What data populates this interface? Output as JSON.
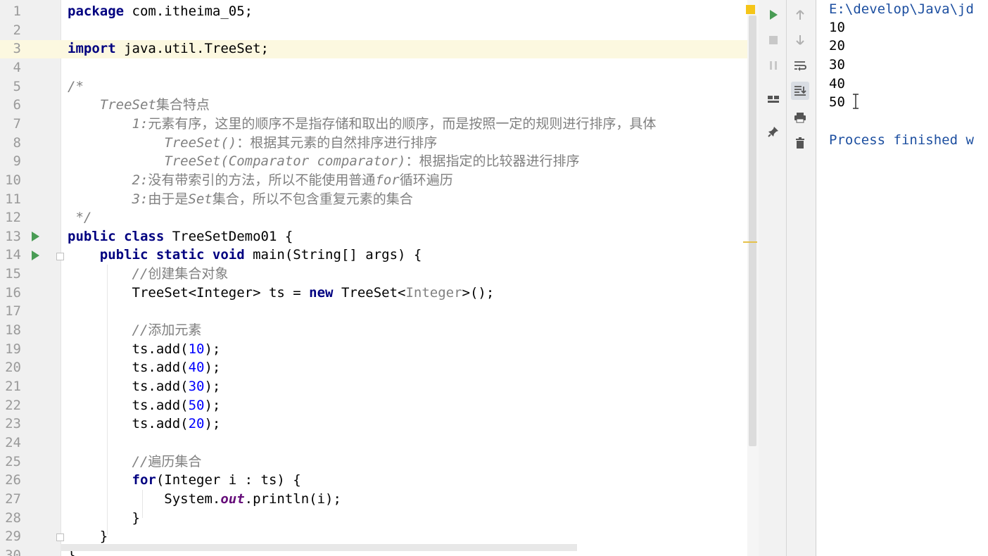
{
  "editor": {
    "lines": [
      {
        "n": "1",
        "parts": [
          {
            "t": "package",
            "c": "kw"
          },
          {
            "t": " com.itheima_05;"
          }
        ]
      },
      {
        "n": "2",
        "parts": []
      },
      {
        "n": "3",
        "parts": [
          {
            "t": "import",
            "c": "kw"
          },
          {
            "t": " java.util.TreeSet;"
          }
        ]
      },
      {
        "n": "4",
        "parts": []
      },
      {
        "n": "5",
        "parts": [
          {
            "t": "/*",
            "c": "cm"
          }
        ]
      },
      {
        "n": "6",
        "parts": [
          {
            "t": "    TreeSet",
            "c": "cm"
          },
          {
            "t": "集合特点",
            "c": "cm2"
          }
        ]
      },
      {
        "n": "7",
        "parts": [
          {
            "t": "        1:",
            "c": "cm"
          },
          {
            "t": "元素有序，这里的顺序不是指存储和取出的顺序，而是按照一定的规则进行排序，具体",
            "c": "cm2"
          }
        ]
      },
      {
        "n": "8",
        "parts": [
          {
            "t": "            TreeSet()",
            "c": "cm"
          },
          {
            "t": "：根据其元素的自然排序进行排序",
            "c": "cm2"
          }
        ]
      },
      {
        "n": "9",
        "parts": [
          {
            "t": "            TreeSet(Comparator comparator)",
            "c": "cm"
          },
          {
            "t": "：根据指定的比较器进行排序",
            "c": "cm2"
          }
        ]
      },
      {
        "n": "10",
        "parts": [
          {
            "t": "        2:",
            "c": "cm"
          },
          {
            "t": "没有带索引的方法，所以不能使用普通",
            "c": "cm2"
          },
          {
            "t": "for",
            "c": "cm"
          },
          {
            "t": "循环遍历",
            "c": "cm2"
          }
        ]
      },
      {
        "n": "11",
        "parts": [
          {
            "t": "        3:",
            "c": "cm"
          },
          {
            "t": "由于是",
            "c": "cm2"
          },
          {
            "t": "Set",
            "c": "cm"
          },
          {
            "t": "集合，所以不包含重复元素的集合",
            "c": "cm2"
          }
        ]
      },
      {
        "n": "12",
        "parts": [
          {
            "t": " */",
            "c": "cm"
          }
        ]
      },
      {
        "n": "13",
        "parts": [
          {
            "t": "public class",
            "c": "kw"
          },
          {
            "t": " TreeSetDemo01 {"
          }
        ]
      },
      {
        "n": "14",
        "parts": [
          {
            "t": "    "
          },
          {
            "t": "public static void",
            "c": "kw"
          },
          {
            "t": " main(String[] args) {"
          }
        ]
      },
      {
        "n": "15",
        "parts": [
          {
            "t": "        //",
            "c": "cm"
          },
          {
            "t": "创建集合对象",
            "c": "cm2"
          }
        ]
      },
      {
        "n": "16",
        "parts": [
          {
            "t": "        TreeSet<Integer> ts = "
          },
          {
            "t": "new",
            "c": "kw"
          },
          {
            "t": " TreeSet<"
          },
          {
            "t": "Integer",
            "c": "gn"
          },
          {
            "t": ">();"
          }
        ]
      },
      {
        "n": "17",
        "parts": []
      },
      {
        "n": "18",
        "parts": [
          {
            "t": "        //",
            "c": "cm"
          },
          {
            "t": "添加元素",
            "c": "cm2"
          }
        ]
      },
      {
        "n": "19",
        "parts": [
          {
            "t": "        ts.add("
          },
          {
            "t": "10",
            "c": "num"
          },
          {
            "t": ");"
          }
        ]
      },
      {
        "n": "20",
        "parts": [
          {
            "t": "        ts.add("
          },
          {
            "t": "40",
            "c": "num"
          },
          {
            "t": ");"
          }
        ]
      },
      {
        "n": "21",
        "parts": [
          {
            "t": "        ts.add("
          },
          {
            "t": "30",
            "c": "num"
          },
          {
            "t": ");"
          }
        ]
      },
      {
        "n": "22",
        "parts": [
          {
            "t": "        ts.add("
          },
          {
            "t": "50",
            "c": "num"
          },
          {
            "t": ");"
          }
        ]
      },
      {
        "n": "23",
        "parts": [
          {
            "t": "        ts.add("
          },
          {
            "t": "20",
            "c": "num"
          },
          {
            "t": ");"
          }
        ]
      },
      {
        "n": "24",
        "parts": []
      },
      {
        "n": "25",
        "parts": [
          {
            "t": "        //",
            "c": "cm"
          },
          {
            "t": "遍历集合",
            "c": "cm2"
          }
        ]
      },
      {
        "n": "26",
        "parts": [
          {
            "t": "        "
          },
          {
            "t": "for",
            "c": "kw"
          },
          {
            "t": "(Integer i : ts) {"
          }
        ]
      },
      {
        "n": "27",
        "parts": [
          {
            "t": "            System."
          },
          {
            "t": "out",
            "c": "st"
          },
          {
            "t": ".println(i);"
          }
        ]
      },
      {
        "n": "28",
        "parts": [
          {
            "t": "        }"
          }
        ]
      },
      {
        "n": "29",
        "parts": [
          {
            "t": "    }"
          }
        ]
      },
      {
        "n": "30",
        "parts": [
          {
            "t": "}"
          }
        ]
      }
    ],
    "highlighted_line": "3"
  },
  "toolbar": {
    "run_icon": "play-icon",
    "stop_icon": "stop-icon",
    "pause_icon": "pause-icon",
    "layout_icon": "layout-icon",
    "pin_icon": "pin-icon",
    "up_icon": "arrow-up-icon",
    "down_icon": "arrow-down-icon",
    "wrap_icon": "soft-wrap-icon",
    "scroll_end_icon": "scroll-to-end-icon",
    "print_icon": "print-icon",
    "trash_icon": "trash-icon"
  },
  "console": {
    "command": "E:\\develop\\Java\\jd",
    "output": [
      "10",
      "20",
      "30",
      "40",
      "50"
    ],
    "blank": "",
    "finish": "Process finished w"
  }
}
